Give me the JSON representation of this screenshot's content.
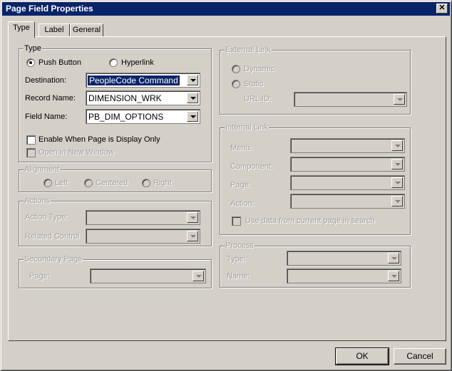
{
  "window": {
    "title": "Page Field Properties"
  },
  "tabs": [
    "Type",
    "Label",
    "General"
  ],
  "type_group": {
    "title": "Type",
    "push_button": "Push Button",
    "hyperlink": "Hyperlink",
    "destination_label": "Destination:",
    "destination_value": "PeopleCode Command",
    "record_label": "Record Name:",
    "record_value": "DIMENSION_WRK",
    "field_label": "Field Name:",
    "field_value": "PB_DIM_OPTIONS",
    "enable_display_only": "Enable When Page is Display Only",
    "open_new_window": "Open in New Window"
  },
  "alignment": {
    "title": "Alignment",
    "left": "Left",
    "centered": "Centered",
    "right": "Right"
  },
  "actions": {
    "title": "Actions",
    "action_type": "Action Type:",
    "related_control": "Related Control"
  },
  "secondary_page": {
    "title": "Secondary Page",
    "page": "Page:"
  },
  "external_link": {
    "title": "External Link",
    "dynamic": "Dynamic",
    "static": "Static",
    "url_id": "URL ID:"
  },
  "internal_link": {
    "title": "Internal Link",
    "menu": "Menu:",
    "component": "Component:",
    "page": "Page:",
    "action": "Action:",
    "use_data": "Use data from current page in search"
  },
  "process": {
    "title": "Process",
    "type": "Type:",
    "name": "Name:"
  },
  "buttons": {
    "ok": "OK",
    "cancel": "Cancel"
  }
}
